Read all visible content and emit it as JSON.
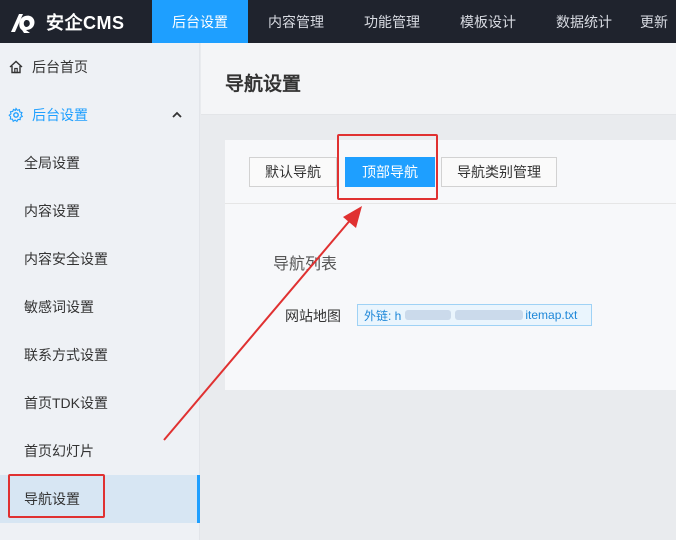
{
  "brand": {
    "name": "安企CMS",
    "logo": "anqi-logo-icon"
  },
  "topnav": [
    {
      "label": "后台设置",
      "active": true
    },
    {
      "label": "内容管理",
      "active": false
    },
    {
      "label": "功能管理",
      "active": false
    },
    {
      "label": "模板设计",
      "active": false
    },
    {
      "label": "数据统计",
      "active": false
    },
    {
      "label": "更新",
      "active": false
    }
  ],
  "sidebar": {
    "home": {
      "label": "后台首页",
      "icon": "home-icon"
    },
    "group": {
      "label": "后台设置",
      "icon": "gear-icon",
      "expanded": true
    },
    "items": [
      {
        "label": "全局设置"
      },
      {
        "label": "内容设置"
      },
      {
        "label": "内容安全设置"
      },
      {
        "label": "敏感词设置"
      },
      {
        "label": "联系方式设置"
      },
      {
        "label": "首页TDK设置"
      },
      {
        "label": "首页幻灯片"
      },
      {
        "label": "导航设置",
        "current": true
      }
    ]
  },
  "page": {
    "title": "导航设置",
    "tabs": [
      {
        "label": "默认导航",
        "active": false
      },
      {
        "label": "顶部导航",
        "active": true
      },
      {
        "label": "导航类别管理",
        "active": false
      }
    ],
    "section_title": "导航列表",
    "nav_row": {
      "name": "网站地图",
      "link_prefix": "外链: h",
      "link_suffix": "itemap.txt"
    }
  },
  "colors": {
    "accent": "#1e9fff",
    "annotation": "#e03131",
    "topbar": "#1f232d"
  }
}
